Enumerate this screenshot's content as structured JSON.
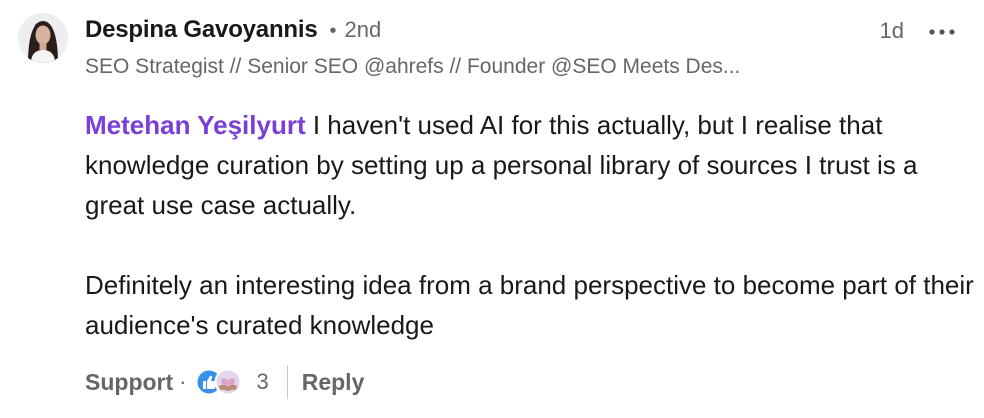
{
  "comment": {
    "author": {
      "name": "Despina Gavoyannis",
      "separator": "•",
      "connection_degree": "2nd",
      "headline": "SEO Strategist // Senior SEO @ahrefs // Founder @SEO Meets Des..."
    },
    "timestamp": "1d",
    "more_menu_icon": "ellipsis-icon",
    "mention": "Metehan Yeşilyurt",
    "paragraph_1": "I haven't used AI for this actually, but I realise that knowledge curation by setting up a personal library of sources I trust is a great use case actually.",
    "paragraph_2": "Definitely an interesting idea from a brand perspective to become part of their audience's curated knowledge"
  },
  "actions": {
    "support_label": "Support",
    "dot": "·",
    "reactions": {
      "icons": [
        "like-reaction-icon",
        "support-reaction-icon"
      ],
      "count": "3"
    },
    "reply_label": "Reply"
  },
  "colors": {
    "mention": "#7a3fd8",
    "secondary_text": "#666666",
    "primary_text": "#191919",
    "like_blue": "#378fe9",
    "support_pink": "#d9a5c8"
  }
}
